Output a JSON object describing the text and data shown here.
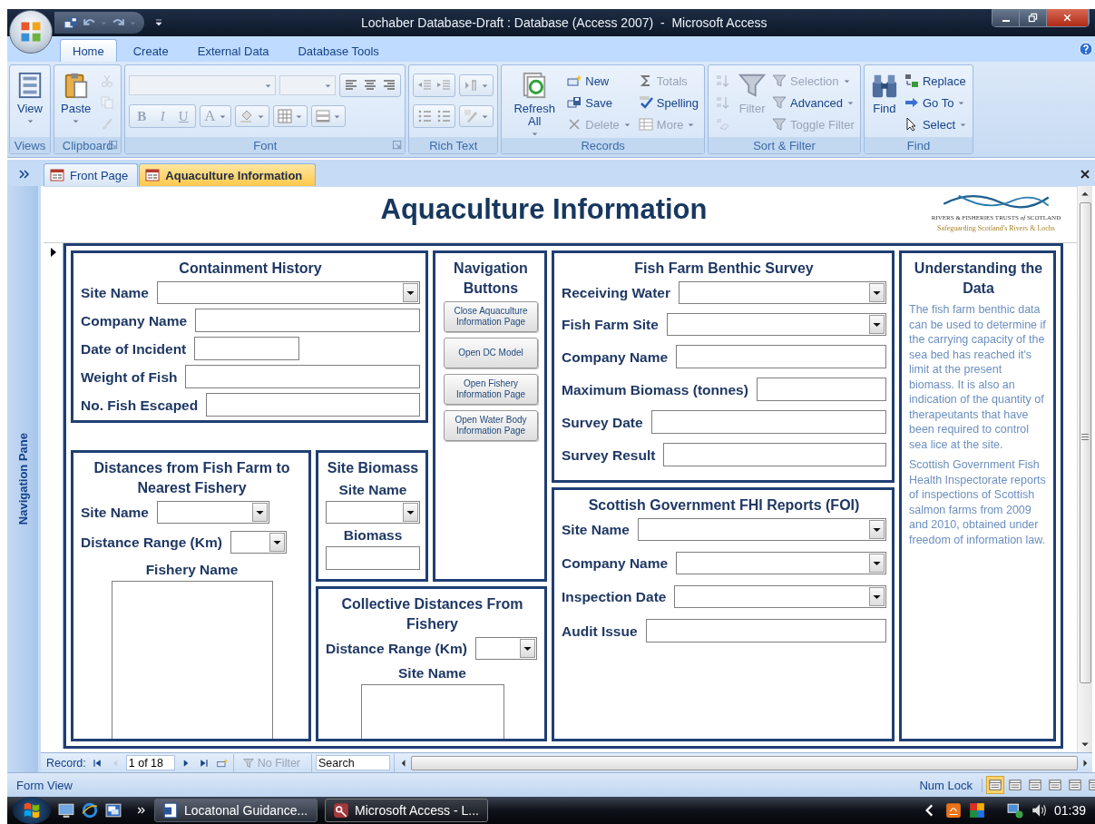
{
  "window": {
    "title": "Lochaber Database-Draft : Database (Access 2007)  -  Microsoft Access"
  },
  "ribbon": {
    "tabs": [
      {
        "label": "Home",
        "selected": true
      },
      {
        "label": "Create",
        "selected": false
      },
      {
        "label": "External Data",
        "selected": false
      },
      {
        "label": "Database Tools",
        "selected": false
      }
    ],
    "groups": [
      {
        "kind": "commands",
        "label": "Views",
        "launcher": false,
        "commands": [
          {
            "kind": "large",
            "label": "View",
            "dropdown": true,
            "disabled": false
          }
        ]
      },
      {
        "kind": "commands",
        "label": "Clipboard",
        "launcher": true,
        "commands": [
          {
            "kind": "large",
            "label": "Paste",
            "dropdown": true,
            "disabled": false
          },
          {
            "kind": "icon",
            "disabled": true
          },
          {
            "kind": "icon",
            "disabled": true
          },
          {
            "kind": "icon",
            "disabled": true
          }
        ]
      },
      {
        "kind": "font",
        "label": "Font",
        "launcher": true,
        "buttons": [
          {
            "label": "B",
            "disabled": true
          },
          {
            "label": "I",
            "disabled": true
          },
          {
            "label": "U",
            "disabled": true
          },
          {
            "label": "A",
            "disabled": true
          }
        ]
      },
      {
        "kind": "richtext",
        "label": "Rich Text",
        "launcher": false
      },
      {
        "kind": "commands",
        "label": "Records",
        "launcher": false,
        "commands": [
          {
            "kind": "large",
            "label": "Refresh All",
            "dropdown": true,
            "disabled": false
          },
          {
            "kind": "small",
            "label": "New",
            "dropdown": false,
            "disabled": false
          },
          {
            "kind": "small",
            "label": "Save",
            "dropdown": false,
            "disabled": false
          },
          {
            "kind": "small",
            "label": "Delete",
            "dropdown": true,
            "disabled": true
          },
          {
            "kind": "small",
            "label": "Totals",
            "dropdown": false,
            "disabled": true
          },
          {
            "kind": "small",
            "label": "Spelling",
            "dropdown": false,
            "disabled": false
          },
          {
            "kind": "small",
            "label": "More",
            "dropdown": true,
            "disabled": true
          }
        ]
      },
      {
        "kind": "commands",
        "label": "Sort & Filter",
        "launcher": false,
        "commands": [
          {
            "kind": "icon",
            "disabled": true
          },
          {
            "kind": "icon",
            "disabled": true
          },
          {
            "kind": "icon",
            "disabled": true
          },
          {
            "kind": "large",
            "label": "Filter",
            "dropdown": false,
            "disabled": true
          },
          {
            "kind": "small",
            "label": "Selection",
            "dropdown": true,
            "disabled": true
          },
          {
            "kind": "small",
            "label": "Advanced",
            "dropdown": true,
            "disabled": false
          },
          {
            "kind": "small",
            "label": "Toggle Filter",
            "dropdown": false,
            "disabled": true
          }
        ]
      },
      {
        "kind": "commands",
        "label": "Find",
        "launcher": false,
        "commands": [
          {
            "kind": "large",
            "label": "Find",
            "dropdown": false,
            "disabled": false
          },
          {
            "kind": "small",
            "label": "Replace",
            "dropdown": false,
            "disabled": false
          },
          {
            "kind": "small",
            "label": "Go To",
            "dropdown": true,
            "disabled": false
          },
          {
            "kind": "small",
            "label": "Select",
            "dropdown": true,
            "disabled": false
          }
        ]
      }
    ]
  },
  "navigation_pane": {
    "label": "Navigation Pane"
  },
  "documents": {
    "tabs": [
      {
        "label": "Front Page",
        "selected": false
      },
      {
        "label": "Aquaculture Information",
        "selected": true
      }
    ]
  },
  "form": {
    "title": "Aquaculture Information",
    "logo": {
      "name": "RIVERS & FISHERIES TRUSTS *of* SCOTLAND",
      "tagline": "Safeguarding Scotland's Rivers & Lochs"
    },
    "panels": [
      {
        "kind": "rows",
        "title": "Containment History",
        "fields": [
          {
            "label": "Site Name",
            "kind": "combo"
          },
          {
            "label": "Company Name",
            "kind": "text"
          },
          {
            "label": "Date of Incident",
            "kind": "text"
          },
          {
            "label": "Weight of Fish",
            "kind": "text"
          },
          {
            "label": "No. Fish Escaped",
            "kind": "text"
          }
        ]
      },
      {
        "kind": "rows",
        "title": "Distances from Fish Farm to Nearest Fishery",
        "fields": [
          {
            "label": "Site Name",
            "kind": "combo"
          },
          {
            "label": "Distance Range (Km)",
            "kind": "combo"
          },
          {
            "label": "Fishery Name",
            "kind": "listbox"
          }
        ]
      },
      {
        "kind": "stacked",
        "title": "Site Biomass",
        "fields": [
          {
            "label": "Site Name",
            "kind": "combo"
          },
          {
            "label": "Biomass",
            "kind": "text"
          }
        ]
      },
      {
        "kind": "buttons",
        "title": "Navigation Buttons",
        "buttons": [
          "Close Aquaculture Information Page",
          "Open DC Model",
          "Open Fishery Information Page",
          "Open Water Body Information Page"
        ]
      },
      {
        "kind": "rows",
        "title": "Collective Distances From Fishery",
        "fields": [
          {
            "label": "Distance Range (Km)",
            "kind": "combo"
          },
          {
            "label": "Site Name",
            "kind": "listbox"
          }
        ]
      },
      {
        "kind": "rows",
        "title": "Fish Farm Benthic Survey",
        "fields": [
          {
            "label": "Receiving Water",
            "kind": "combo"
          },
          {
            "label": "Fish Farm Site",
            "kind": "combo"
          },
          {
            "label": "Company Name",
            "kind": "text"
          },
          {
            "label": "Maximum Biomass (tonnes)",
            "kind": "text"
          },
          {
            "label": "Survey Date",
            "kind": "text"
          },
          {
            "label": "Survey Result",
            "kind": "text"
          }
        ]
      },
      {
        "kind": "rows",
        "title": "Scottish Government FHI Reports (FOI)",
        "fields": [
          {
            "label": "Site Name",
            "kind": "combo"
          },
          {
            "label": "Company Name",
            "kind": "combo"
          },
          {
            "label": "Inspection Date",
            "kind": "combo"
          },
          {
            "label": "Audit Issue",
            "kind": "text"
          }
        ]
      },
      {
        "kind": "text",
        "title": "Understanding the Data",
        "paragraphs": [
          "The fish farm benthic data can be used to determine if the carrying capacity of the sea bed has reached it's limit at the present biomass. It is also an indication of the quantity of therapeutants that have been required to control sea lice at the site.",
          "Scottish Government Fish Health Inspectorate reports of inspections of Scottish salmon farms from 2009 and 2010, obtained under freedom of information law."
        ]
      }
    ]
  },
  "record_bar": {
    "label": "Record:",
    "position": "1 of 18",
    "buttons": [
      {
        "disabled": false
      },
      {
        "disabled": true
      },
      {
        "disabled": false
      },
      {
        "disabled": false
      },
      {
        "disabled": false
      }
    ],
    "filter": {
      "label": "No Filter",
      "disabled": true
    },
    "search": {
      "placeholder": "Search"
    }
  },
  "status_bar": {
    "text": "Form View",
    "indicator": "Num Lock",
    "views": [
      {
        "selected": true
      },
      {
        "selected": false
      },
      {
        "selected": false
      },
      {
        "selected": false
      },
      {
        "selected": false
      },
      {
        "selected": false
      }
    ]
  },
  "taskbar": {
    "tasks": [
      {
        "label": "Locatonal Guidance...",
        "selected": false
      },
      {
        "label": "Microsoft Access - L...",
        "selected": true
      }
    ],
    "clock": "01:39"
  }
}
